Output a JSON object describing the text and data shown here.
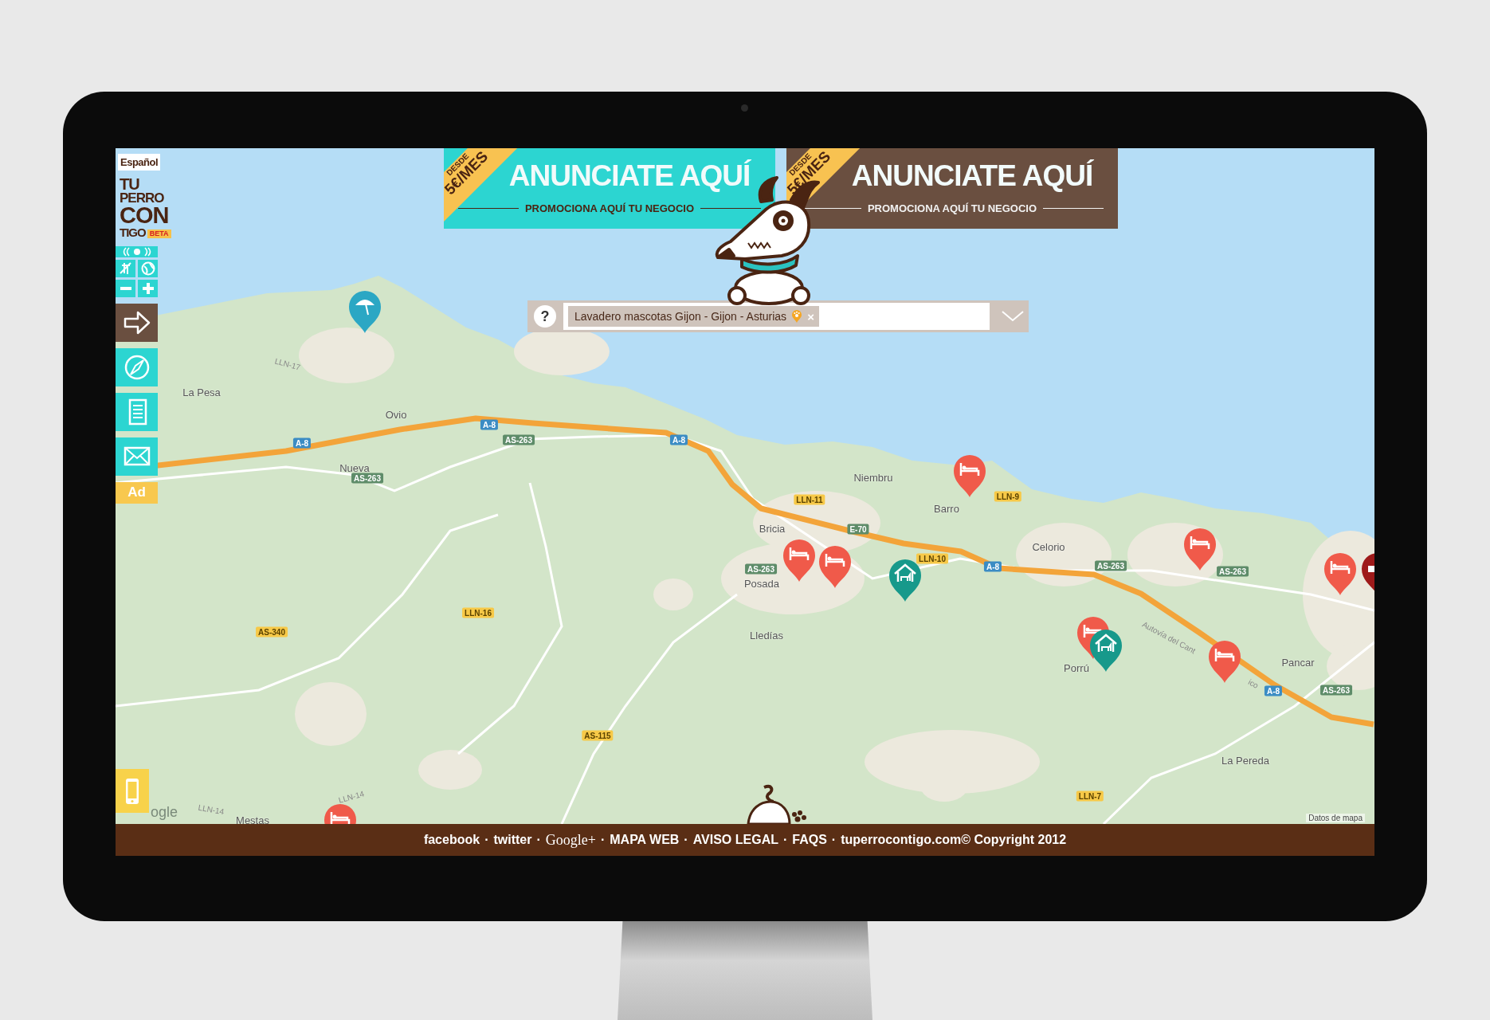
{
  "language_button": "Español",
  "logo": {
    "lines": [
      "TU",
      "PERRO",
      "CON",
      "TIGO"
    ],
    "badge": "BETA"
  },
  "sidebar": {
    "ad_label": "Ad"
  },
  "banners": [
    {
      "color": "#2cd5d1",
      "ribbon_top": "DESDE",
      "ribbon_price": "5€/MES",
      "title": "ANUNCIATE AQUÍ",
      "subtitle": "PROMOCIONA AQUÍ TU NEGOCIO"
    },
    {
      "color": "#6a4f40",
      "ribbon_top": "DESDE",
      "ribbon_price": "5€/MES",
      "title": "ANUNCIATE AQUÍ",
      "subtitle": "PROMOCIONA AQUÍ TU NEGOCIO"
    }
  ],
  "search": {
    "help": "?",
    "tags": [
      {
        "text": "Lavadero mascotas Gijon - Gijon - Asturias",
        "remove": "×"
      }
    ]
  },
  "map": {
    "places": [
      "La Pesa",
      "Ovio",
      "Nueva",
      "Niembru",
      "Barro",
      "Bricia",
      "Celorio",
      "Posada",
      "Lledías",
      "Porrú",
      "Pancar",
      "La Pereda",
      "Mestas"
    ],
    "road_labels": [
      {
        "text": "LLN-17",
        "kind": "plain"
      },
      {
        "text": "A-8",
        "kind": "motorway"
      },
      {
        "text": "A-8",
        "kind": "motorway"
      },
      {
        "text": "AS-263",
        "kind": "regional"
      },
      {
        "text": "AS-263",
        "kind": "regional"
      },
      {
        "text": "A-8",
        "kind": "motorway"
      },
      {
        "text": "LLN-11",
        "kind": "local"
      },
      {
        "text": "LLN-9",
        "kind": "local"
      },
      {
        "text": "E-70",
        "kind": "regional"
      },
      {
        "text": "LLN-10",
        "kind": "local"
      },
      {
        "text": "AS-263",
        "kind": "regional"
      },
      {
        "text": "A-8",
        "kind": "motorway"
      },
      {
        "text": "AS-263",
        "kind": "regional"
      },
      {
        "text": "AS-263",
        "kind": "regional"
      },
      {
        "text": "LLN-16",
        "kind": "local"
      },
      {
        "text": "AS-340",
        "kind": "local"
      },
      {
        "text": "Autovía del Cant",
        "kind": "plain"
      },
      {
        "text": "ico",
        "kind": "plain"
      },
      {
        "text": "A-8",
        "kind": "motorway"
      },
      {
        "text": "AS-263",
        "kind": "regional"
      },
      {
        "text": "AS-115",
        "kind": "local"
      },
      {
        "text": "LLN-7",
        "kind": "local"
      },
      {
        "text": "LLN-14",
        "kind": "plain"
      },
      {
        "text": "LLN-14",
        "kind": "plain"
      }
    ],
    "pins": [
      {
        "kind": "beach",
        "color": "#2ba7c4"
      },
      {
        "kind": "hotel",
        "color": "#f05a4a"
      },
      {
        "kind": "hotel",
        "color": "#f05a4a"
      },
      {
        "kind": "hotel",
        "color": "#f05a4a"
      },
      {
        "kind": "kennel",
        "color": "#17998b"
      },
      {
        "kind": "hotel",
        "color": "#f05a4a"
      },
      {
        "kind": "clinic",
        "color": "#9e1a1a"
      },
      {
        "kind": "hotel",
        "color": "#f05a4a"
      },
      {
        "kind": "hotel",
        "color": "#f05a4a"
      },
      {
        "kind": "kennel",
        "color": "#17998b"
      },
      {
        "kind": "hotel",
        "color": "#f05a4a"
      },
      {
        "kind": "hotel",
        "color": "#f05a4a"
      }
    ],
    "provider": "ogle",
    "attribution": "Datos de mapa"
  },
  "footer": {
    "items": [
      {
        "kind": "link",
        "text": "facebook"
      },
      {
        "kind": "separator",
        "text": "·"
      },
      {
        "kind": "link",
        "text": "twitter"
      },
      {
        "kind": "separator",
        "text": "·"
      },
      {
        "kind": "link",
        "text": "Google+"
      },
      {
        "kind": "separator",
        "text": "·"
      },
      {
        "kind": "link",
        "text": "MAPA WEB"
      },
      {
        "kind": "separator",
        "text": "·"
      },
      {
        "kind": "link",
        "text": "AVISO LEGAL"
      },
      {
        "kind": "separator",
        "text": "·"
      },
      {
        "kind": "link",
        "text": "FAQS"
      },
      {
        "kind": "separator",
        "text": "·"
      },
      {
        "kind": "text",
        "text": "tuperrocontigo.com© Copyright 2012"
      }
    ]
  }
}
